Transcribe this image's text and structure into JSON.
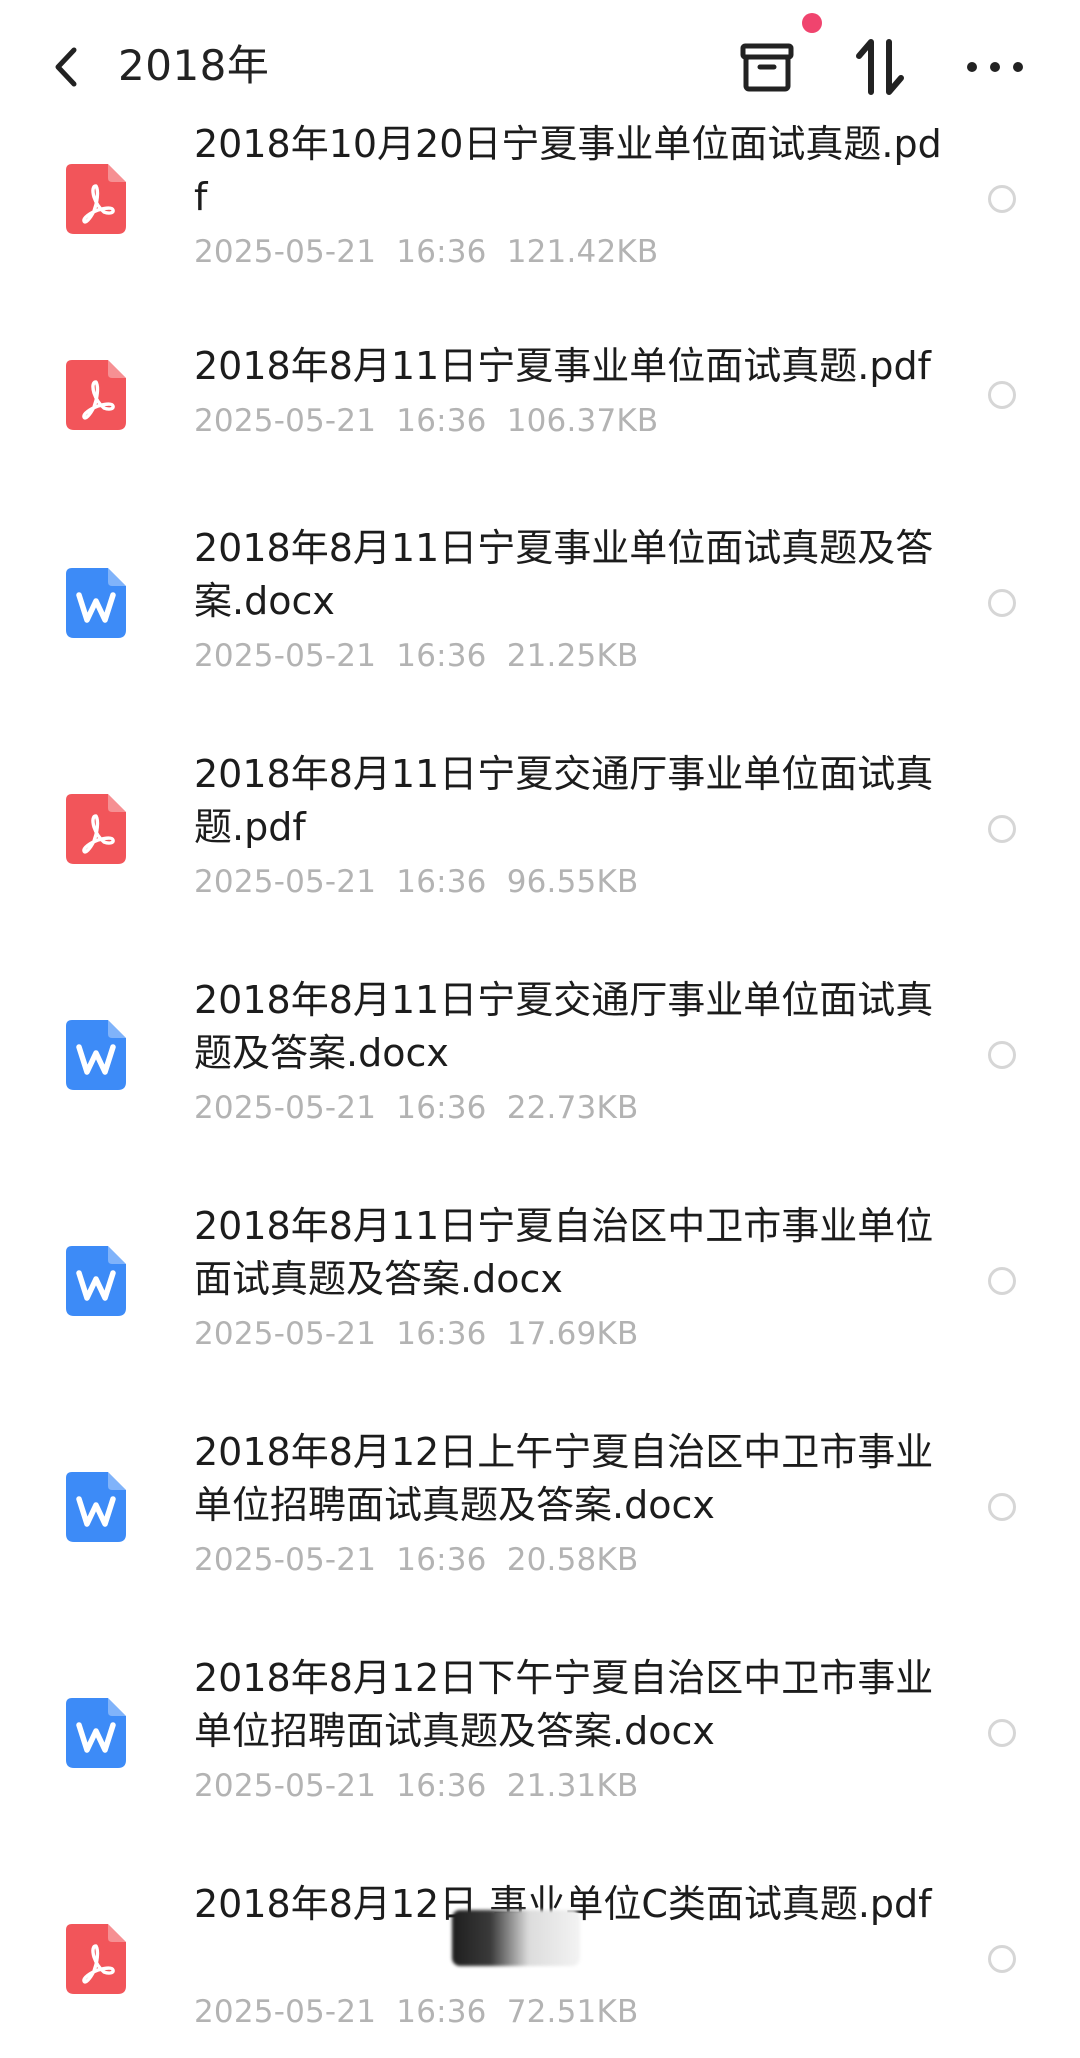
{
  "header": {
    "title": "2018年",
    "badge_color": "#F0446E"
  },
  "colors": {
    "pdf_icon": "#F2555A",
    "word_icon": "#3D8BF7",
    "meta_text": "#B3B3B3"
  },
  "files": [
    {
      "type": "pdf-icon",
      "name": "2018年10月20日宁夏事业单位面试真题.pdf",
      "meta": "2025-05-21  16:36  121.42KB"
    },
    {
      "type": "pdf-icon",
      "name": "2018年8月11日宁夏事业单位面试真题.pdf",
      "meta": "2025-05-21  16:36  106.37KB"
    },
    {
      "type": "word-icon",
      "name": "2018年8月11日宁夏事业单位面试真题及答案.docx",
      "meta": "2025-05-21  16:36  21.25KB"
    },
    {
      "type": "pdf-icon",
      "name": "2018年8月11日宁夏交通厅事业单位面试真题.pdf",
      "meta": "2025-05-21  16:36  96.55KB"
    },
    {
      "type": "word-icon",
      "name": "2018年8月11日宁夏交通厅事业单位面试真题及答案.docx",
      "meta": "2025-05-21  16:36  22.73KB"
    },
    {
      "type": "word-icon",
      "name": "2018年8月11日宁夏自治区中卫市事业单位面试真题及答案.docx",
      "meta": "2025-05-21  16:36  17.69KB"
    },
    {
      "type": "word-icon",
      "name": "2018年8月12日上午宁夏自治区中卫市事业单位招聘面试真题及答案.docx",
      "meta": "2025-05-21  16:36  20.58KB"
    },
    {
      "type": "word-icon",
      "name": "2018年8月12日下午宁夏自治区中卫市事业单位招聘面试真题及答案.docx",
      "meta": "2025-05-21  16:36  21.31KB"
    },
    {
      "type": "pdf-icon",
      "name": "2018年8月12日        事业单位C类面试真题.pdf",
      "meta": "2025-05-21  16:36  72.51KB"
    }
  ]
}
